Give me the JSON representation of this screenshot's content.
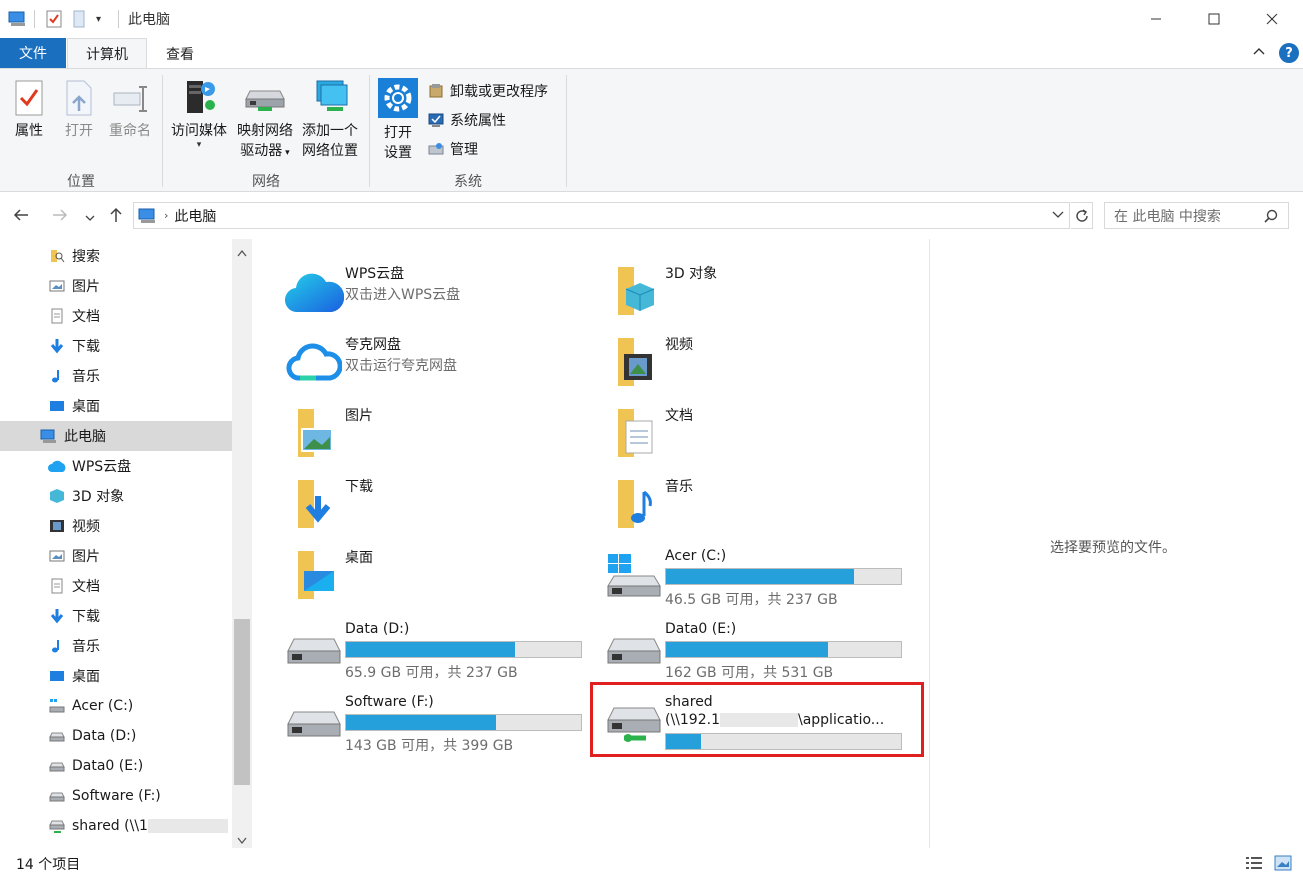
{
  "window": {
    "title": "此电脑",
    "minimize": "—",
    "maximize": "☐",
    "close": "✕"
  },
  "tabs": {
    "file": "文件",
    "computer": "计算机",
    "view": "查看",
    "help": "?"
  },
  "ribbon": {
    "properties": "属性",
    "open": "打开",
    "rename": "重命名",
    "group_location": "位置",
    "access_media": "访问媒体",
    "map_drive_line1": "映射网络",
    "map_drive_line2": "驱动器",
    "add_location_line1": "添加一个",
    "add_location_line2": "网络位置",
    "group_network": "网络",
    "open_settings_line1": "打开",
    "open_settings_line2": "设置",
    "uninstall": "卸载或更改程序",
    "system_properties": "系统属性",
    "manage": "管理",
    "group_system": "系统"
  },
  "address": {
    "path": "此电脑",
    "search_placeholder": "在 此电脑 中搜索"
  },
  "nav": [
    {
      "label": "搜索",
      "icon": "search-folder-icon"
    },
    {
      "label": "图片",
      "icon": "pictures-icon"
    },
    {
      "label": "文档",
      "icon": "documents-icon"
    },
    {
      "label": "下载",
      "icon": "downloads-icon"
    },
    {
      "label": "音乐",
      "icon": "music-icon"
    },
    {
      "label": "桌面",
      "icon": "desktop-icon"
    },
    {
      "label": "此电脑",
      "icon": "this-pc-icon"
    },
    {
      "label": "WPS云盘",
      "icon": "wps-cloud-icon"
    },
    {
      "label": "3D 对象",
      "icon": "3d-objects-icon"
    },
    {
      "label": "视频",
      "icon": "videos-icon"
    },
    {
      "label": "图片",
      "icon": "pictures-icon"
    },
    {
      "label": "文档",
      "icon": "documents-icon"
    },
    {
      "label": "下载",
      "icon": "downloads-icon"
    },
    {
      "label": "音乐",
      "icon": "music-icon"
    },
    {
      "label": "桌面",
      "icon": "desktop-icon"
    },
    {
      "label": "Acer (C:)",
      "icon": "drive-c-icon"
    },
    {
      "label": "Data (D:)",
      "icon": "drive-icon"
    },
    {
      "label": "Data0 (E:)",
      "icon": "drive-icon"
    },
    {
      "label": "Software (F:)",
      "icon": "drive-icon"
    },
    {
      "label": "shared (\\\\1",
      "icon": "network-drive-icon"
    }
  ],
  "items": {
    "wps": {
      "name": "WPS云盘",
      "sub": "双击进入WPS云盘"
    },
    "quark": {
      "name": "夸克网盘",
      "sub": "双击运行夸克网盘"
    },
    "pictures": {
      "name": "图片"
    },
    "downloads": {
      "name": "下载"
    },
    "desktop": {
      "name": "桌面"
    },
    "objects3d": {
      "name": "3D 对象"
    },
    "videos": {
      "name": "视频"
    },
    "documents": {
      "name": "文档"
    },
    "music": {
      "name": "音乐"
    },
    "drive_c": {
      "name": "Acer (C:)",
      "sub": "46.5 GB 可用，共 237 GB",
      "used_fraction": 0.8
    },
    "drive_d": {
      "name": "Data (D:)",
      "sub": "65.9 GB 可用，共 237 GB",
      "used_fraction": 0.72
    },
    "drive_e": {
      "name": "Data0 (E:)",
      "sub": "162 GB 可用，共 531 GB",
      "used_fraction": 0.69
    },
    "drive_f": {
      "name": "Software (F:)",
      "sub": "143 GB 可用，共 399 GB",
      "used_fraction": 0.64
    },
    "shared": {
      "name": "shared",
      "path_start": "(\\\\192.1",
      "path_end": "\\applicatio...",
      "used_fraction": 0.15
    }
  },
  "preview": {
    "text": "选择要预览的文件。"
  },
  "status": {
    "count": "14 个项目"
  },
  "colors": {
    "accent": "#1a6fbf",
    "bar_fill": "#26a0da",
    "highlight": "#e0201e"
  }
}
